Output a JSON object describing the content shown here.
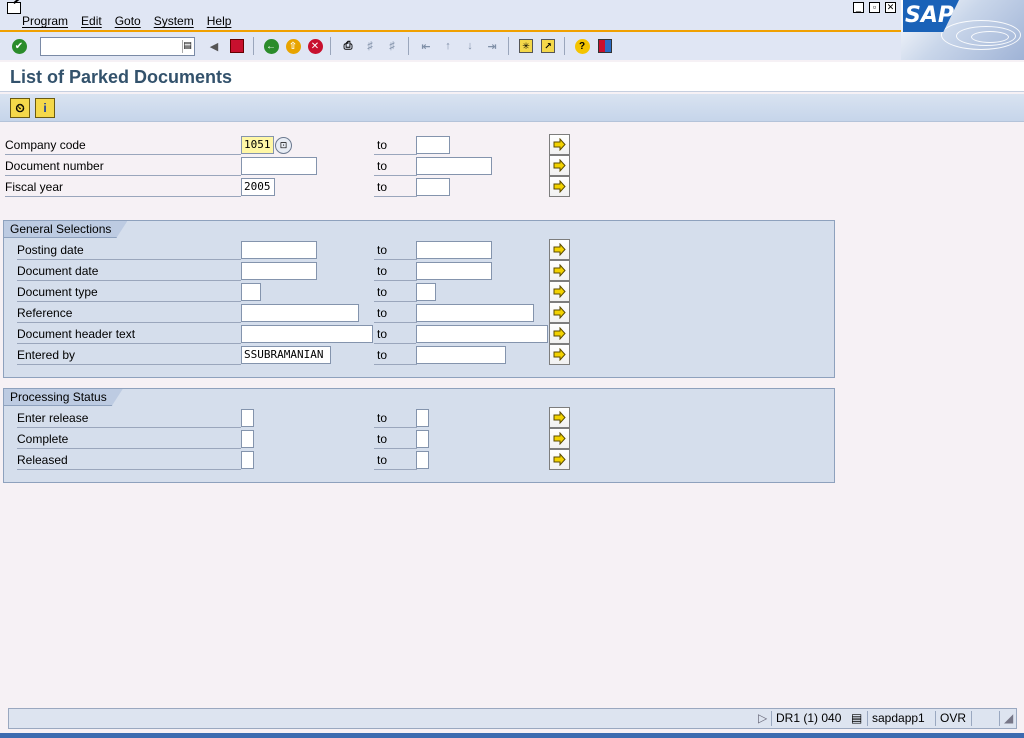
{
  "menu": {
    "items": [
      "Program",
      "Edit",
      "Goto",
      "System",
      "Help"
    ],
    "logo_text": "SAP"
  },
  "toolbar": {
    "command_field_value": "",
    "icons": [
      "enter-icon",
      "dropdown-icon",
      "back-nav-icon",
      "save-icon",
      "back-icon",
      "exit-icon",
      "cancel-icon",
      "print-icon",
      "find-icon",
      "find-next-icon",
      "first-page-icon",
      "prev-page-icon",
      "next-page-icon",
      "last-page-icon",
      "create-session-icon",
      "shortcut-icon",
      "help-icon",
      "layout-icon"
    ]
  },
  "page": {
    "title": "List of Parked Documents"
  },
  "app_toolbar": {
    "icons": [
      "execute-icon",
      "info-icon"
    ]
  },
  "main_fields": [
    {
      "label": "Company code",
      "from": "1051",
      "to": "",
      "to_label": "to"
    },
    {
      "label": "Document number",
      "from": "",
      "to": "",
      "to_label": "to"
    },
    {
      "label": "Fiscal year",
      "from": "2005",
      "to": "",
      "to_label": "to"
    }
  ],
  "general_selections": {
    "title": "General Selections",
    "fields": [
      {
        "label": "Posting date",
        "from": "",
        "to": "",
        "to_label": "to"
      },
      {
        "label": "Document date",
        "from": "",
        "to": "",
        "to_label": "to"
      },
      {
        "label": "Document type",
        "from": "",
        "to": "",
        "to_label": "to"
      },
      {
        "label": "Reference",
        "from": "",
        "to": "",
        "to_label": "to"
      },
      {
        "label": "Document header text",
        "from": "",
        "to": "",
        "to_label": "to"
      },
      {
        "label": "Entered by",
        "from": "SSUBRAMANIAN",
        "to": "",
        "to_label": "to"
      }
    ]
  },
  "processing_status": {
    "title": "Processing Status",
    "fields": [
      {
        "label": "Enter release",
        "from": "",
        "to": "",
        "to_label": "to"
      },
      {
        "label": "Complete",
        "from": "",
        "to": "",
        "to_label": "to"
      },
      {
        "label": "Released",
        "from": "",
        "to": "",
        "to_label": "to"
      }
    ]
  },
  "status_bar": {
    "system": "DR1 (1) 040",
    "server": "sapdapp1",
    "mode": "OVR"
  },
  "colors": {
    "accent": "#f0a000",
    "title": "#33526c",
    "required_field": "#fff7a6"
  }
}
